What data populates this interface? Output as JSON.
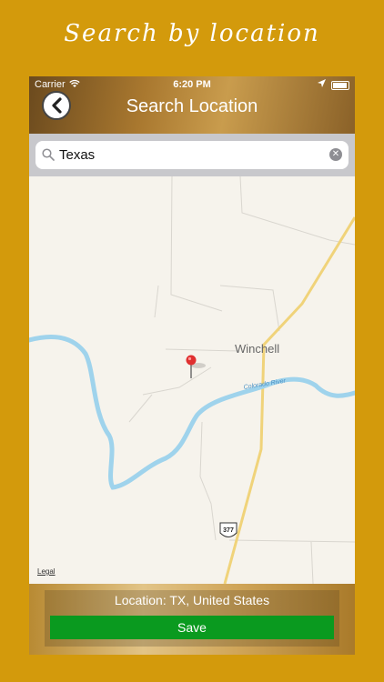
{
  "promo": {
    "title": "Search by location"
  },
  "status_bar": {
    "carrier": "Carrier",
    "time": "6:20 PM"
  },
  "nav": {
    "title": "Search Location",
    "back_icon": "chevron-left-icon"
  },
  "search": {
    "value": "Texas",
    "icon": "search-icon",
    "clear_icon": "clear-icon"
  },
  "map": {
    "place_label": "Winchell",
    "river_label": "Colorado River",
    "highway_label": "377",
    "legal": "Legal",
    "colors": {
      "water": "#9fd3ec",
      "road": "#f0d37a",
      "land": "#f6f3ec"
    }
  },
  "footer": {
    "location_text": "Location: TX, United States",
    "save_label": "Save"
  },
  "colors": {
    "background": "#D39A0C",
    "save_button": "#0a9a1f"
  }
}
